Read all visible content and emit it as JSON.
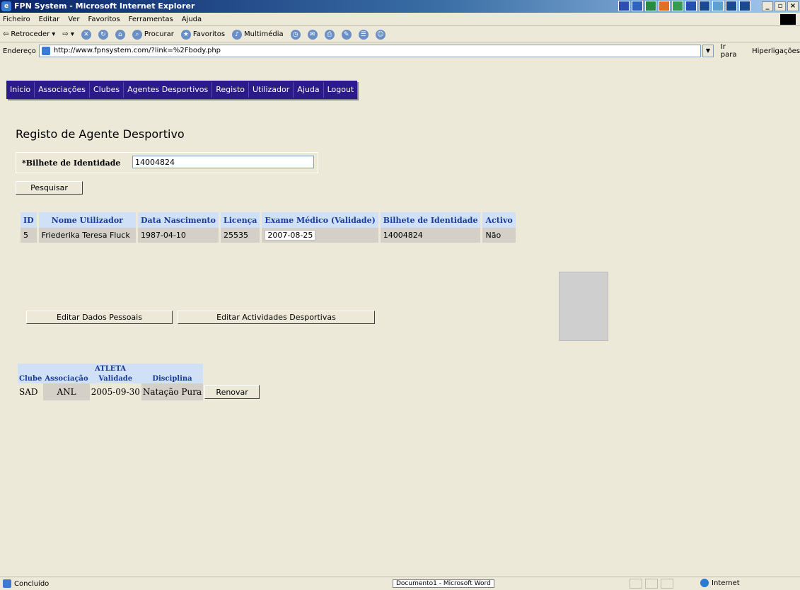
{
  "window": {
    "title": "FPN System - Microsoft Internet Explorer",
    "controls": [
      "_",
      "▫",
      "×"
    ]
  },
  "menu": [
    "Ficheiro",
    "Editar",
    "Ver",
    "Favoritos",
    "Ferramentas",
    "Ajuda"
  ],
  "toolbar": {
    "back": "Retroceder",
    "search": "Procurar",
    "favorites": "Favoritos",
    "multimedia": "Multimédia"
  },
  "address": {
    "label": "Endereço",
    "url": "http://www.fpnsystem.com/?link=%2Fbody.php",
    "go": "Ir para",
    "links": "Hiperligações"
  },
  "nav": [
    "Inicio",
    "Associações",
    "Clubes",
    "Agentes Desportivos",
    "Registo",
    "Utilizador",
    "Ajuda",
    "Logout"
  ],
  "page": {
    "heading": "Registo de Agente Desportivo",
    "search_label": "*Bilhete de Identidade",
    "search_value": "14004824",
    "search_button": "Pesquisar"
  },
  "results": {
    "headers": [
      "ID",
      "Nome Utilizador",
      "Data Nascimento",
      "Licença",
      "Exame Médico (Validade)",
      "Bilhete de Identidade",
      "Activo"
    ],
    "row": [
      "5",
      "Friederika Teresa Fluck",
      "1987-04-10",
      "25535",
      "2007-08-25",
      "14004824",
      "Não"
    ],
    "edit_personal": "Editar Dados Pessoais",
    "edit_sports": "Editar Actividades Desportivas"
  },
  "athlete": {
    "group_header": "ATLETA",
    "headers": [
      "Clube",
      "Associação",
      "Validade",
      "Disciplina"
    ],
    "row": [
      "SAD",
      "ANL",
      "2005-09-30",
      "Natação Pura"
    ],
    "renew_button": "Renovar"
  },
  "status": {
    "text": "Concluído",
    "taskbar": "Documento1 - Microsoft Word",
    "zone": "Internet"
  }
}
